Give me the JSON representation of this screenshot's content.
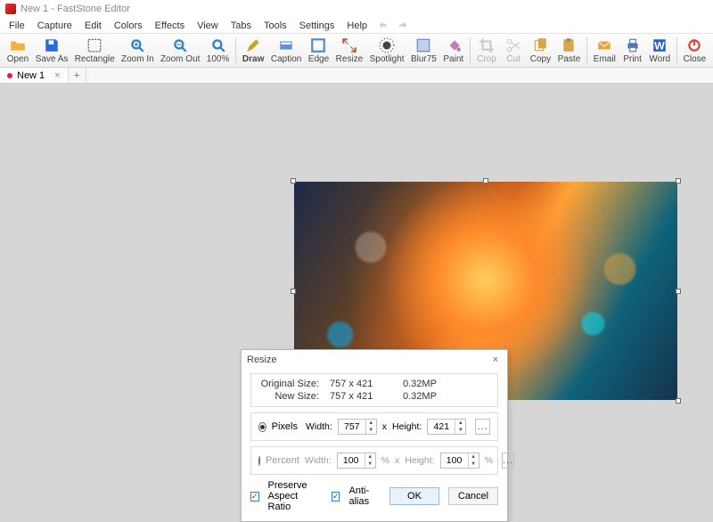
{
  "window": {
    "title": "New 1 - FastStone Editor"
  },
  "menu": {
    "items": [
      "File",
      "Capture",
      "Edit",
      "Colors",
      "Effects",
      "View",
      "Tabs",
      "Tools",
      "Settings",
      "Help"
    ]
  },
  "toolbar": {
    "groups": [
      [
        {
          "name": "open",
          "label": "Open",
          "icon": "folder-open",
          "color": "#f3b23a"
        },
        {
          "name": "saveas",
          "label": "Save As",
          "icon": "floppy",
          "color": "#2b6bd4"
        },
        {
          "name": "rectangle",
          "label": "Rectangle",
          "icon": "marquee",
          "color": "#555"
        },
        {
          "name": "zoomin",
          "label": "Zoom In",
          "icon": "zoom-in",
          "color": "#2d7fc7"
        },
        {
          "name": "zoomout",
          "label": "Zoom Out",
          "icon": "zoom-out",
          "color": "#2d7fc7"
        },
        {
          "name": "zoom100",
          "label": "100%",
          "icon": "zoom-100",
          "color": "#2d7fc7"
        }
      ],
      [
        {
          "name": "draw",
          "label": "Draw",
          "icon": "pencil",
          "color": "#d4a016",
          "bold": true
        },
        {
          "name": "caption",
          "label": "Caption",
          "icon": "caption",
          "color": "#5b93d6"
        },
        {
          "name": "edge",
          "label": "Edge",
          "icon": "edge",
          "color": "#4f8fd1"
        },
        {
          "name": "resize",
          "label": "Resize",
          "icon": "resize",
          "color": "#c4604b"
        },
        {
          "name": "spotlight",
          "label": "Spotlight",
          "icon": "spotlight",
          "color": "#444"
        },
        {
          "name": "blur75",
          "label": "Blur75",
          "icon": "blur",
          "color": "#5f85c8"
        },
        {
          "name": "paint",
          "label": "Paint",
          "icon": "bucket",
          "color": "#c27ab8"
        }
      ],
      [
        {
          "name": "crop",
          "label": "Crop",
          "icon": "crop",
          "color": "#888",
          "disabled": true
        },
        {
          "name": "cut",
          "label": "Cut",
          "icon": "scissors",
          "color": "#888",
          "disabled": true
        },
        {
          "name": "copy",
          "label": "Copy",
          "icon": "copy",
          "color": "#d6a648"
        },
        {
          "name": "paste",
          "label": "Paste",
          "icon": "clipboard",
          "color": "#d6a648"
        }
      ],
      [
        {
          "name": "email",
          "label": "Email",
          "icon": "mail",
          "color": "#e2a63a"
        },
        {
          "name": "print",
          "label": "Print",
          "icon": "printer",
          "color": "#5577aa"
        },
        {
          "name": "word",
          "label": "Word",
          "icon": "word",
          "color": "#2a5fc8"
        }
      ],
      [
        {
          "name": "close",
          "label": "Close",
          "icon": "power",
          "color": "#d24b3e"
        }
      ]
    ]
  },
  "tabs": {
    "items": [
      {
        "label": "New 1",
        "dirty": true
      }
    ]
  },
  "dialog": {
    "title": "Resize",
    "original_label": "Original Size:",
    "new_label": "New Size:",
    "original_dims": "757 x 421",
    "new_dims": "757 x 421",
    "original_mp": "0.32MP",
    "new_mp": "0.32MP",
    "pixels_label": "Pixels",
    "percent_label": "Percent",
    "width_label": "Width:",
    "height_label": "Height:",
    "width_px": "757",
    "height_px": "421",
    "width_pct": "100",
    "height_pct": "100",
    "x_sep": "x",
    "pct_sym": "%",
    "more": "...",
    "preserve": "Preserve Aspect Ratio",
    "antialias": "Anti-alias",
    "ok": "OK",
    "cancel": "Cancel"
  }
}
